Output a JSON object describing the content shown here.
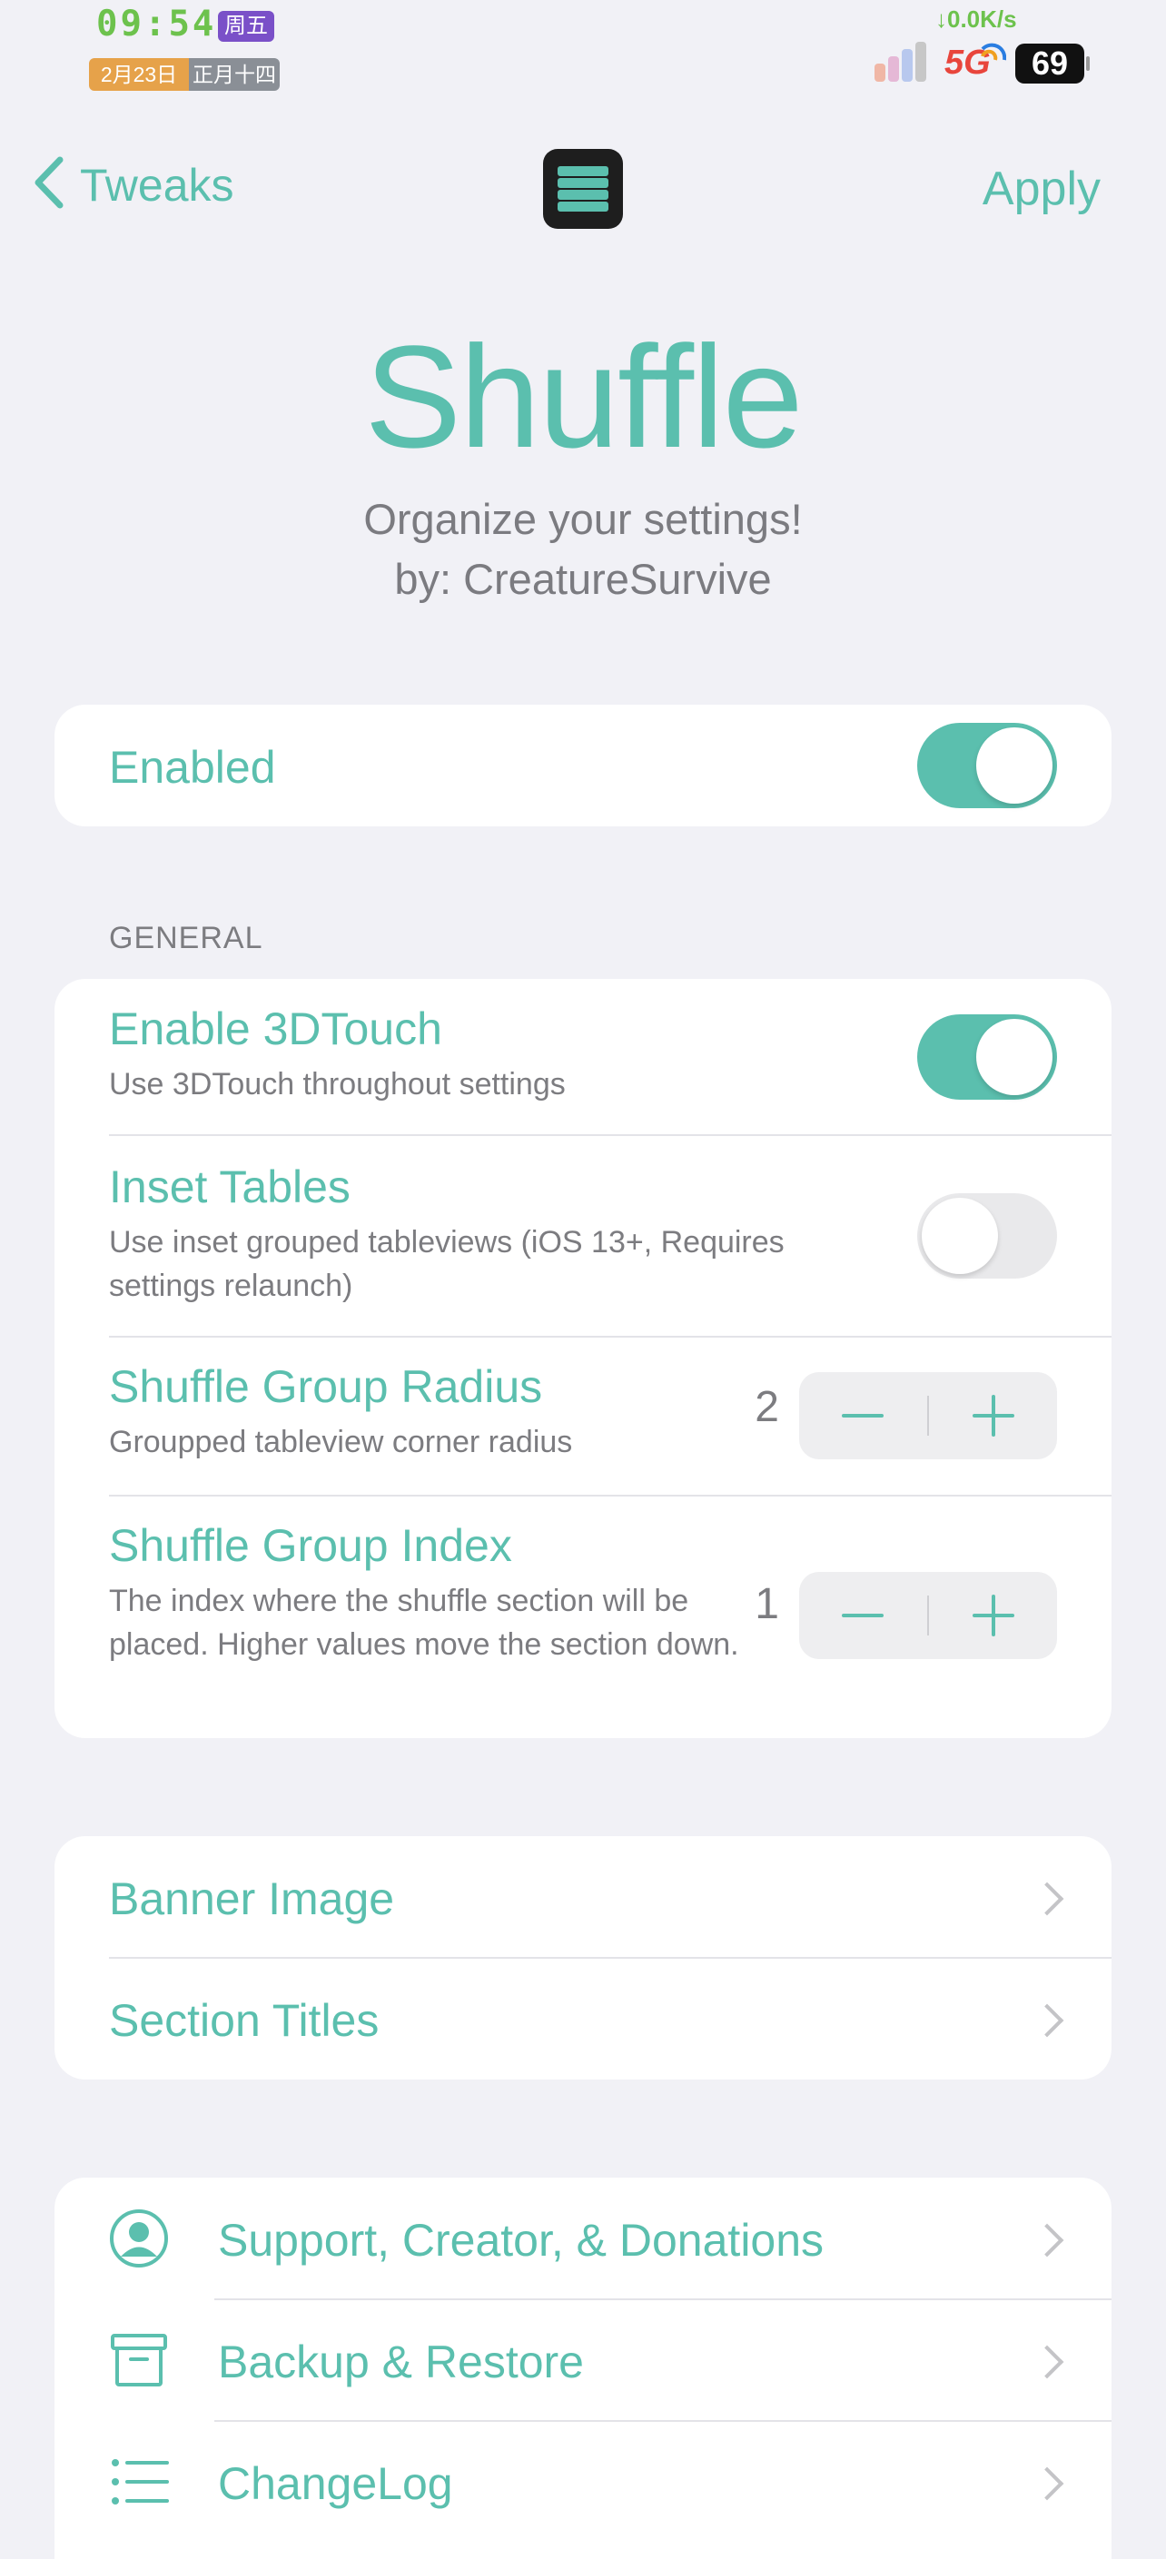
{
  "status_bar": {
    "time": "09:54",
    "weekday": "周五",
    "date": "2月23日",
    "lunar_date": "正月十四",
    "network_speed": "↓0.0K/s",
    "network_type": "5G",
    "battery": "69"
  },
  "nav": {
    "back_label": "Tweaks",
    "apply_label": "Apply",
    "logo_icon": "list-icon"
  },
  "header": {
    "title": "Shuffle",
    "subtitle_line1": "Organize your settings!",
    "subtitle_line2": "by: CreatureSurvive"
  },
  "enabled": {
    "label": "Enabled",
    "value": true
  },
  "general": {
    "header": "GENERAL",
    "enable_3dtouch": {
      "label": "Enable 3DTouch",
      "description": "Use 3DTouch throughout settings",
      "value": true
    },
    "inset_tables": {
      "label": "Inset Tables",
      "description": "Use inset grouped tableviews (iOS 13+, Requires settings relaunch)",
      "value": false
    },
    "group_radius": {
      "label": "Shuffle Group Radius",
      "description": "Groupped tableview corner radius",
      "value": "2"
    },
    "group_index": {
      "label": "Shuffle Group Index",
      "description": "The index where the shuffle section will be placed. Higher values move the section down.",
      "value": "1"
    },
    "minus_symbol": "−",
    "plus_symbol": "+"
  },
  "links": {
    "banner_image": "Banner Image",
    "section_titles": "Section Titles"
  },
  "more": {
    "support": "Support, Creator, & Donations",
    "backup": "Backup & Restore",
    "changelog": "ChangeLog"
  },
  "colors": {
    "accent": "#5bbfae",
    "background": "#f1f1f6",
    "secondary_text": "#7c7c80"
  }
}
